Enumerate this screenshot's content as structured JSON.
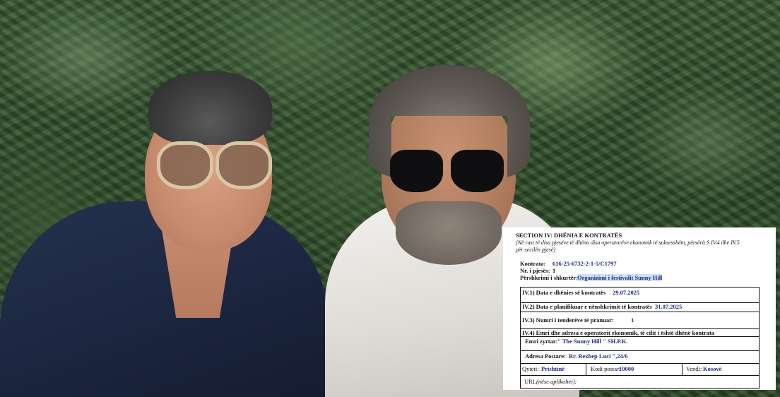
{
  "document": {
    "section_title": "SECTION IV: DHËNIA E KONTRATËS",
    "note_line1": "(Në rast të disa pjesëve të dhëna disa operatorëve ekonomik të suksesshëm, përsërit S IV.4 dhe IV.5",
    "note_line2": "për secilën pjesë)",
    "contract_label": "Kontrata:",
    "contract_value": "616-25-6732-2-1-5/C1797",
    "part_label": "Nr. i pjesës:",
    "part_value": "1",
    "desc_label": "Përshkrimi i shkurtër:",
    "desc_value": "Organizimi i festivalit   Sunny Hill",
    "iv1_label": "IV.1) Data e dhënies së kontratës",
    "iv1_value": "29.07.2025",
    "iv2_label": "IV.2) Data e planifikuar e nënshkrimit të kontratës",
    "iv2_value": "31.07.2025",
    "iv3_label": "IV.3) Numri i tenderëve të pranuar:",
    "iv3_value": "1",
    "iv4_label": "IV.4) Emri dhe adresa e operatorit ekonomik, të cilit i është dhënë kontrata",
    "official_name_label": "Emri zyrtar:",
    "official_name_value": "\" The Sunny Hill \" SH.P.K.",
    "address_label": "Adresa Postare:",
    "address_value": "Rr. Rexhep Luci \",24/6",
    "city_label": "Qyteti:",
    "city_value": "Prishtinë",
    "postal_label": "Kodi postar:",
    "postal_value": "10000",
    "country_label": "Vendi:",
    "country_value": "Kosovë",
    "url_label": "URL",
    "url_note": "(nëse aplikohet):"
  }
}
